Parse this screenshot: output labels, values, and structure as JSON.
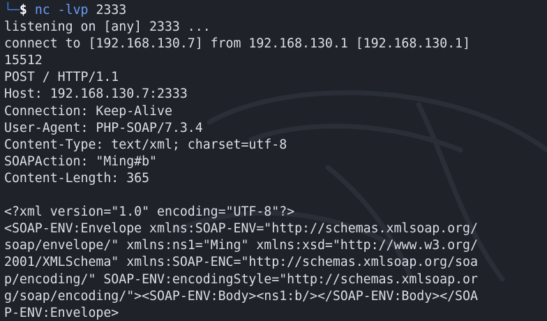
{
  "prompt": {
    "corner": "└─",
    "symbol": "$",
    "command": "nc",
    "flags": "-lvp",
    "port": "2333"
  },
  "output_lines": [
    "listening on [any] 2333 ...",
    "connect to [192.168.130.7] from 192.168.130.1 [192.168.130.1]",
    "15512",
    "POST / HTTP/1.1",
    "Host: 192.168.130.7:2333",
    "Connection: Keep-Alive",
    "User-Agent: PHP-SOAP/7.3.4",
    "Content-Type: text/xml; charset=utf-8",
    "SOAPAction: \"Ming#b\"",
    "Content-Length: 365",
    "",
    "<?xml version=\"1.0\" encoding=\"UTF-8\"?>",
    "<SOAP-ENV:Envelope xmlns:SOAP-ENV=\"http://schemas.xmlsoap.org/",
    "soap/envelope/\" xmlns:ns1=\"Ming\" xmlns:xsd=\"http://www.w3.org/",
    "2001/XMLSchema\" xmlns:SOAP-ENC=\"http://schemas.xmlsoap.org/soa",
    "p/encoding/\" SOAP-ENV:encodingStyle=\"http://schemas.xmlsoap.or",
    "g/soap/encoding/\"><SOAP-ENV:Body><ns1:b/></SOAP-ENV:Body></SOA",
    "P-ENV:Envelope>"
  ]
}
